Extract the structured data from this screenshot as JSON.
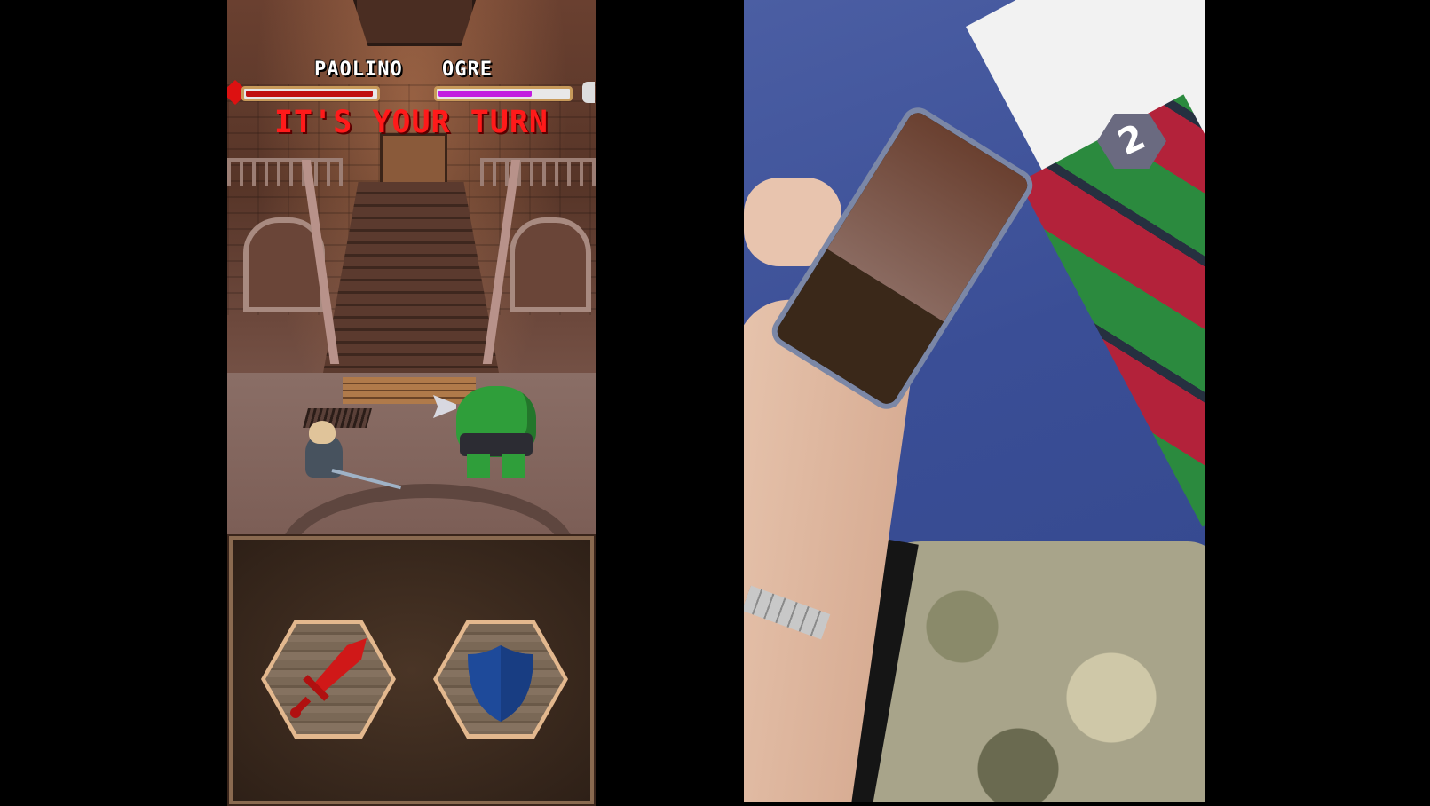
{
  "game": {
    "player_name": "PAOLINO",
    "enemy_name": "OGRE",
    "turn_message": "IT'S YOUR TURN",
    "player_hp_fraction": 0.98,
    "enemy_hp_fraction": 0.72,
    "colors": {
      "player_hp": "#c01010",
      "enemy_hp": "#c21ee0",
      "turn_text": "#ff1a1a",
      "attack_icon": "#d01818",
      "defend_icon": "#1e4a9a"
    },
    "actions": [
      {
        "name": "attack",
        "icon": "sword-icon"
      },
      {
        "name": "defend",
        "icon": "shield-icon"
      }
    ]
  },
  "photo": {
    "token_label": "2"
  }
}
